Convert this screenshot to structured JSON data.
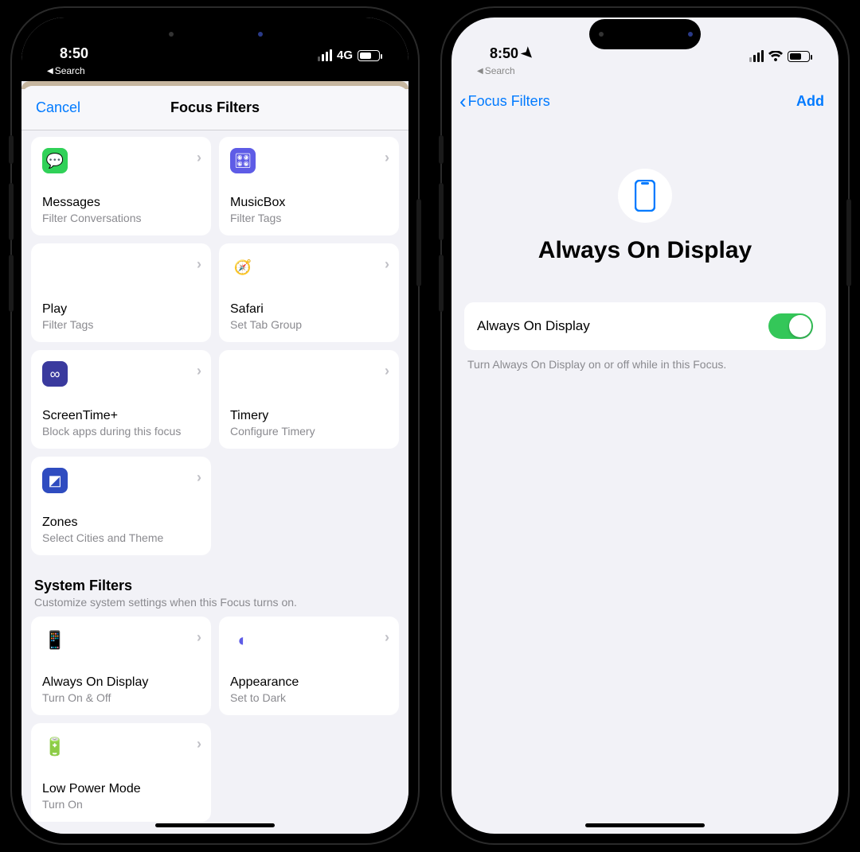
{
  "status": {
    "time": "8:50",
    "carrier": "4G",
    "breadcrumb_label": "Search"
  },
  "screen1": {
    "cancel": "Cancel",
    "title": "Focus Filters",
    "app_filters": [
      {
        "name": "Messages",
        "sub": "Filter Conversations",
        "icon": "messages-icon",
        "bg": "#30d158",
        "glyph": "💬"
      },
      {
        "name": "MusicBox",
        "sub": "Filter Tags",
        "icon": "musicbox-icon",
        "bg": "#5e5ce6",
        "glyph": "🎛"
      },
      {
        "name": "Play",
        "sub": "Filter Tags",
        "icon": "play-icon",
        "bg": "#ffffff",
        "glyph": "▦"
      },
      {
        "name": "Safari",
        "sub": "Set Tab Group",
        "icon": "safari-icon",
        "bg": "#ffffff",
        "glyph": "🧭"
      },
      {
        "name": "ScreenTime+",
        "sub": "Block apps during this focus",
        "icon": "screentime-icon",
        "bg": "#3a3a9e",
        "glyph": "∞"
      },
      {
        "name": "Timery",
        "sub": "Configure Timery",
        "icon": "timery-icon",
        "bg": "#ffffff",
        "glyph": "⏱"
      },
      {
        "name": "Zones",
        "sub": "Select Cities and Theme",
        "icon": "zones-icon",
        "bg": "#2f4cc0",
        "glyph": "◩"
      }
    ],
    "system_section": {
      "title": "System Filters",
      "subtitle": "Customize system settings when this Focus turns on."
    },
    "system_filters": [
      {
        "name": "Always On Display",
        "sub": "Turn On & Off",
        "icon": "aod-icon",
        "glyph": "📱",
        "color": "#5e5ce6"
      },
      {
        "name": "Appearance",
        "sub": "Set to Dark",
        "icon": "appearance-icon",
        "glyph": "◐",
        "color": "#5e5ce6"
      },
      {
        "name": "Low Power Mode",
        "sub": "Turn On",
        "icon": "lpm-icon",
        "glyph": "🔋",
        "color": "#5e5ce6"
      }
    ]
  },
  "screen2": {
    "back_label": "Focus Filters",
    "add_label": "Add",
    "hero_title": "Always On Display",
    "row_label": "Always On Display",
    "toggle_on": true,
    "footer": "Turn Always On Display on or off while in this Focus."
  }
}
